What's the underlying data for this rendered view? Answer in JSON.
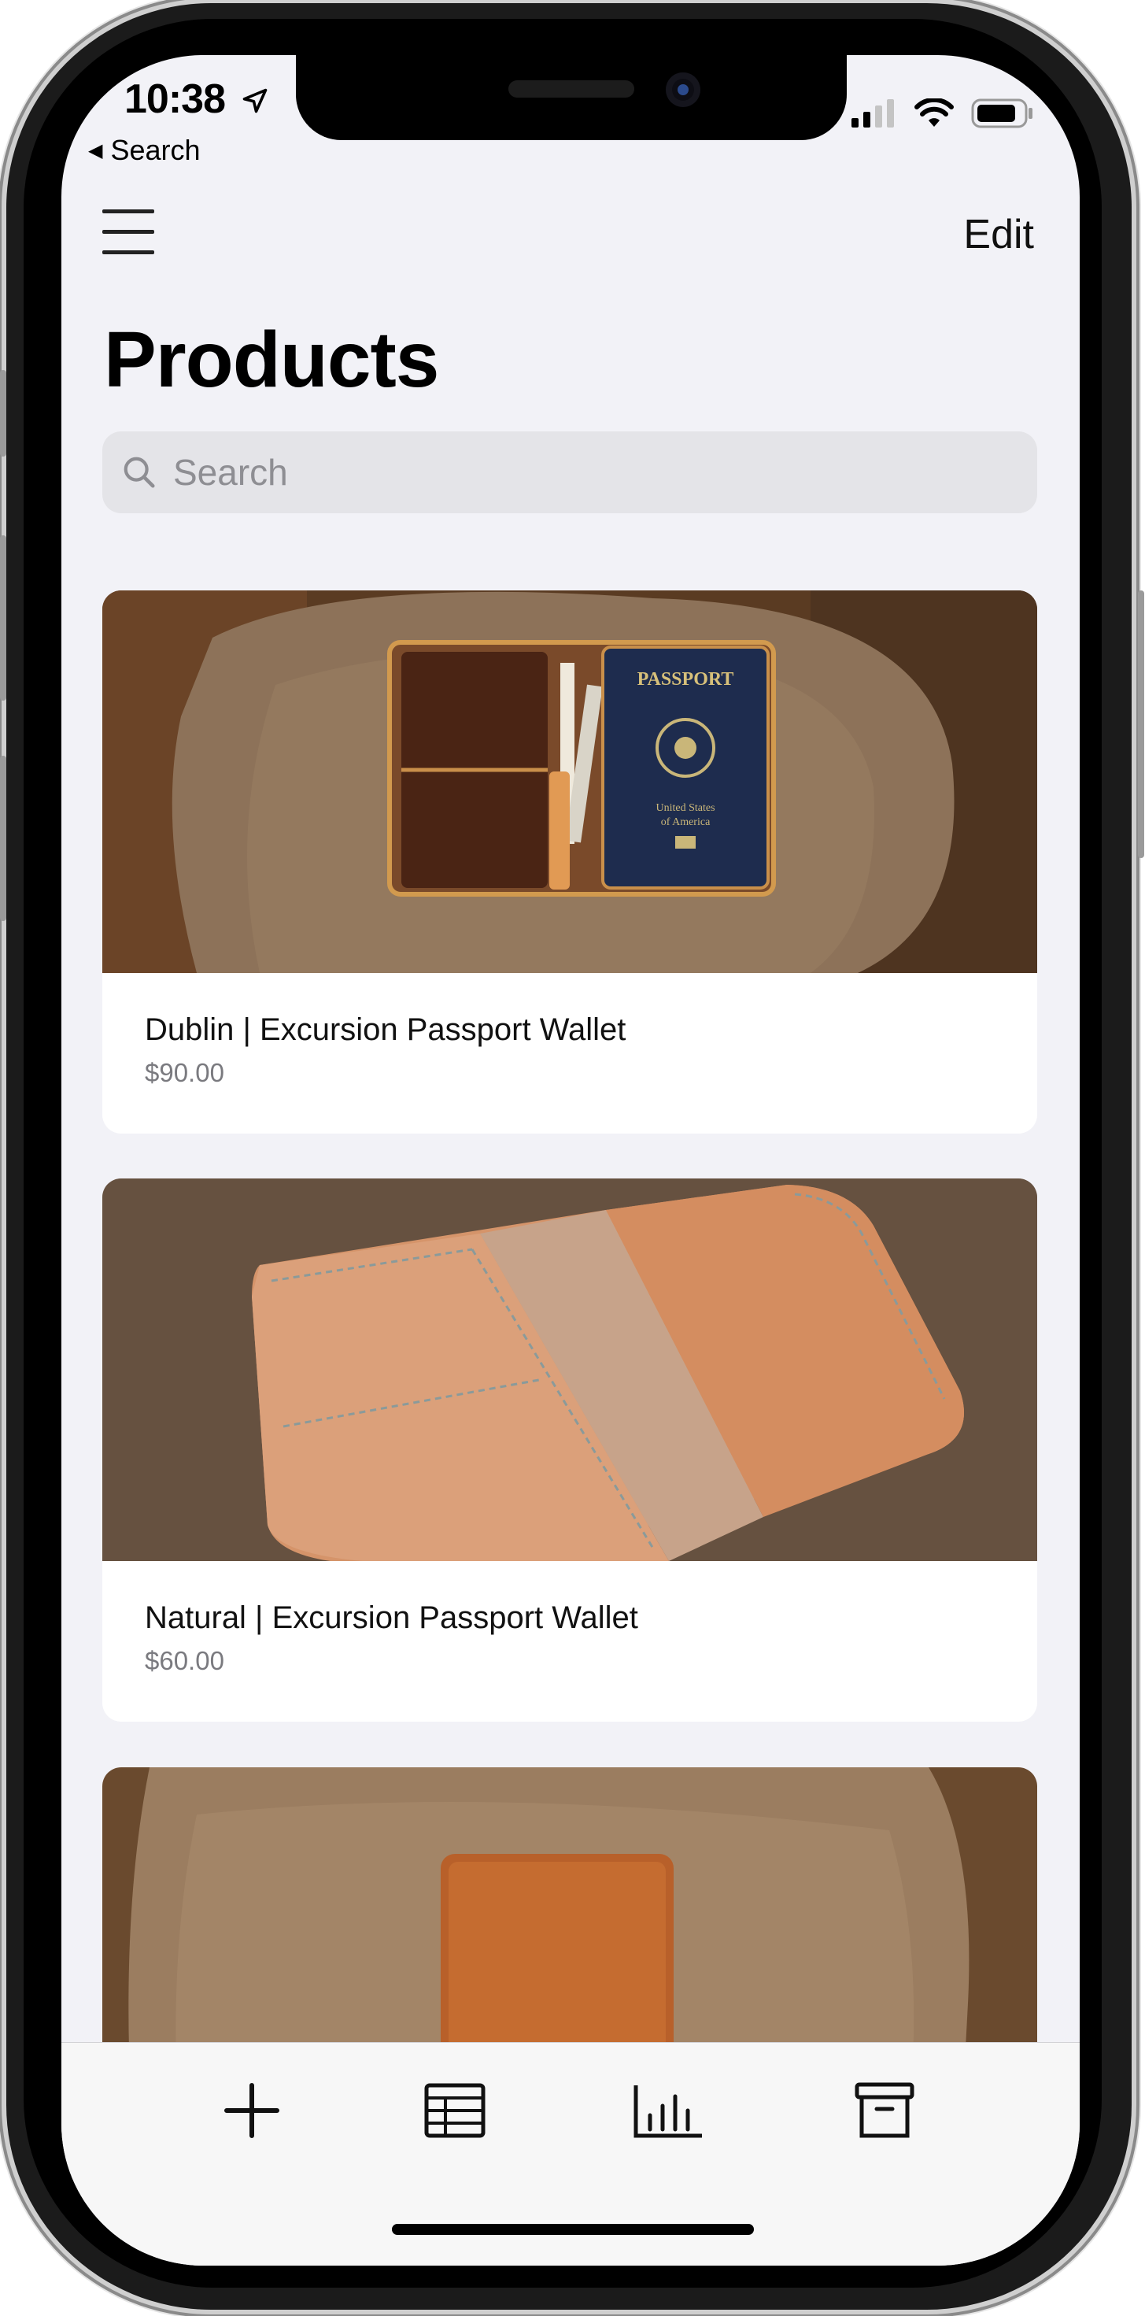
{
  "status_bar": {
    "time": "10:38",
    "back_label": "Search"
  },
  "nav": {
    "edit_label": "Edit",
    "title": "Products"
  },
  "search": {
    "placeholder": "Search"
  },
  "products": [
    {
      "name": "Dublin | Excursion Passport Wallet",
      "price": "$90.00"
    },
    {
      "name": "Natural | Excursion Passport Wallet",
      "price": "$60.00"
    },
    {
      "name": "",
      "price": ""
    }
  ],
  "tab_bar": {
    "icons": [
      "add-icon",
      "table-icon",
      "chart-icon",
      "archive-icon"
    ]
  },
  "colors": {
    "background": "#f2f2f7",
    "card": "#ffffff",
    "secondary_text": "#7a7a7f",
    "leather_dark": "#4a2414",
    "leather_natural": "#d79a72",
    "wood": "#8c6e50"
  }
}
